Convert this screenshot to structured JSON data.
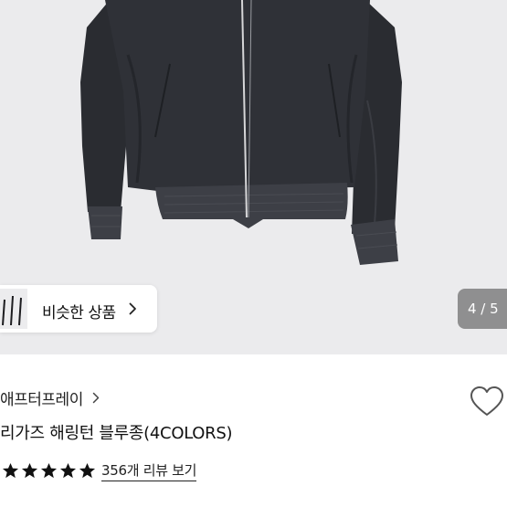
{
  "gallery": {
    "similar_label": "비슷한 상품",
    "page_indicator": "4 / 5"
  },
  "product": {
    "brand": "애프터프레이",
    "title": "리가즈 해링턴 블루종(4COLORS)",
    "rating": 5,
    "review_link": "356개 리뷰 보기"
  },
  "icons": {
    "similar": "chevron-right-icon",
    "brand": "chevron-right-icon",
    "wishlist": "heart-outline-icon",
    "rating": "star-icon"
  },
  "colors": {
    "image_bg": "#ebebed",
    "jacket": "#2b2d33",
    "star": "#111111"
  }
}
